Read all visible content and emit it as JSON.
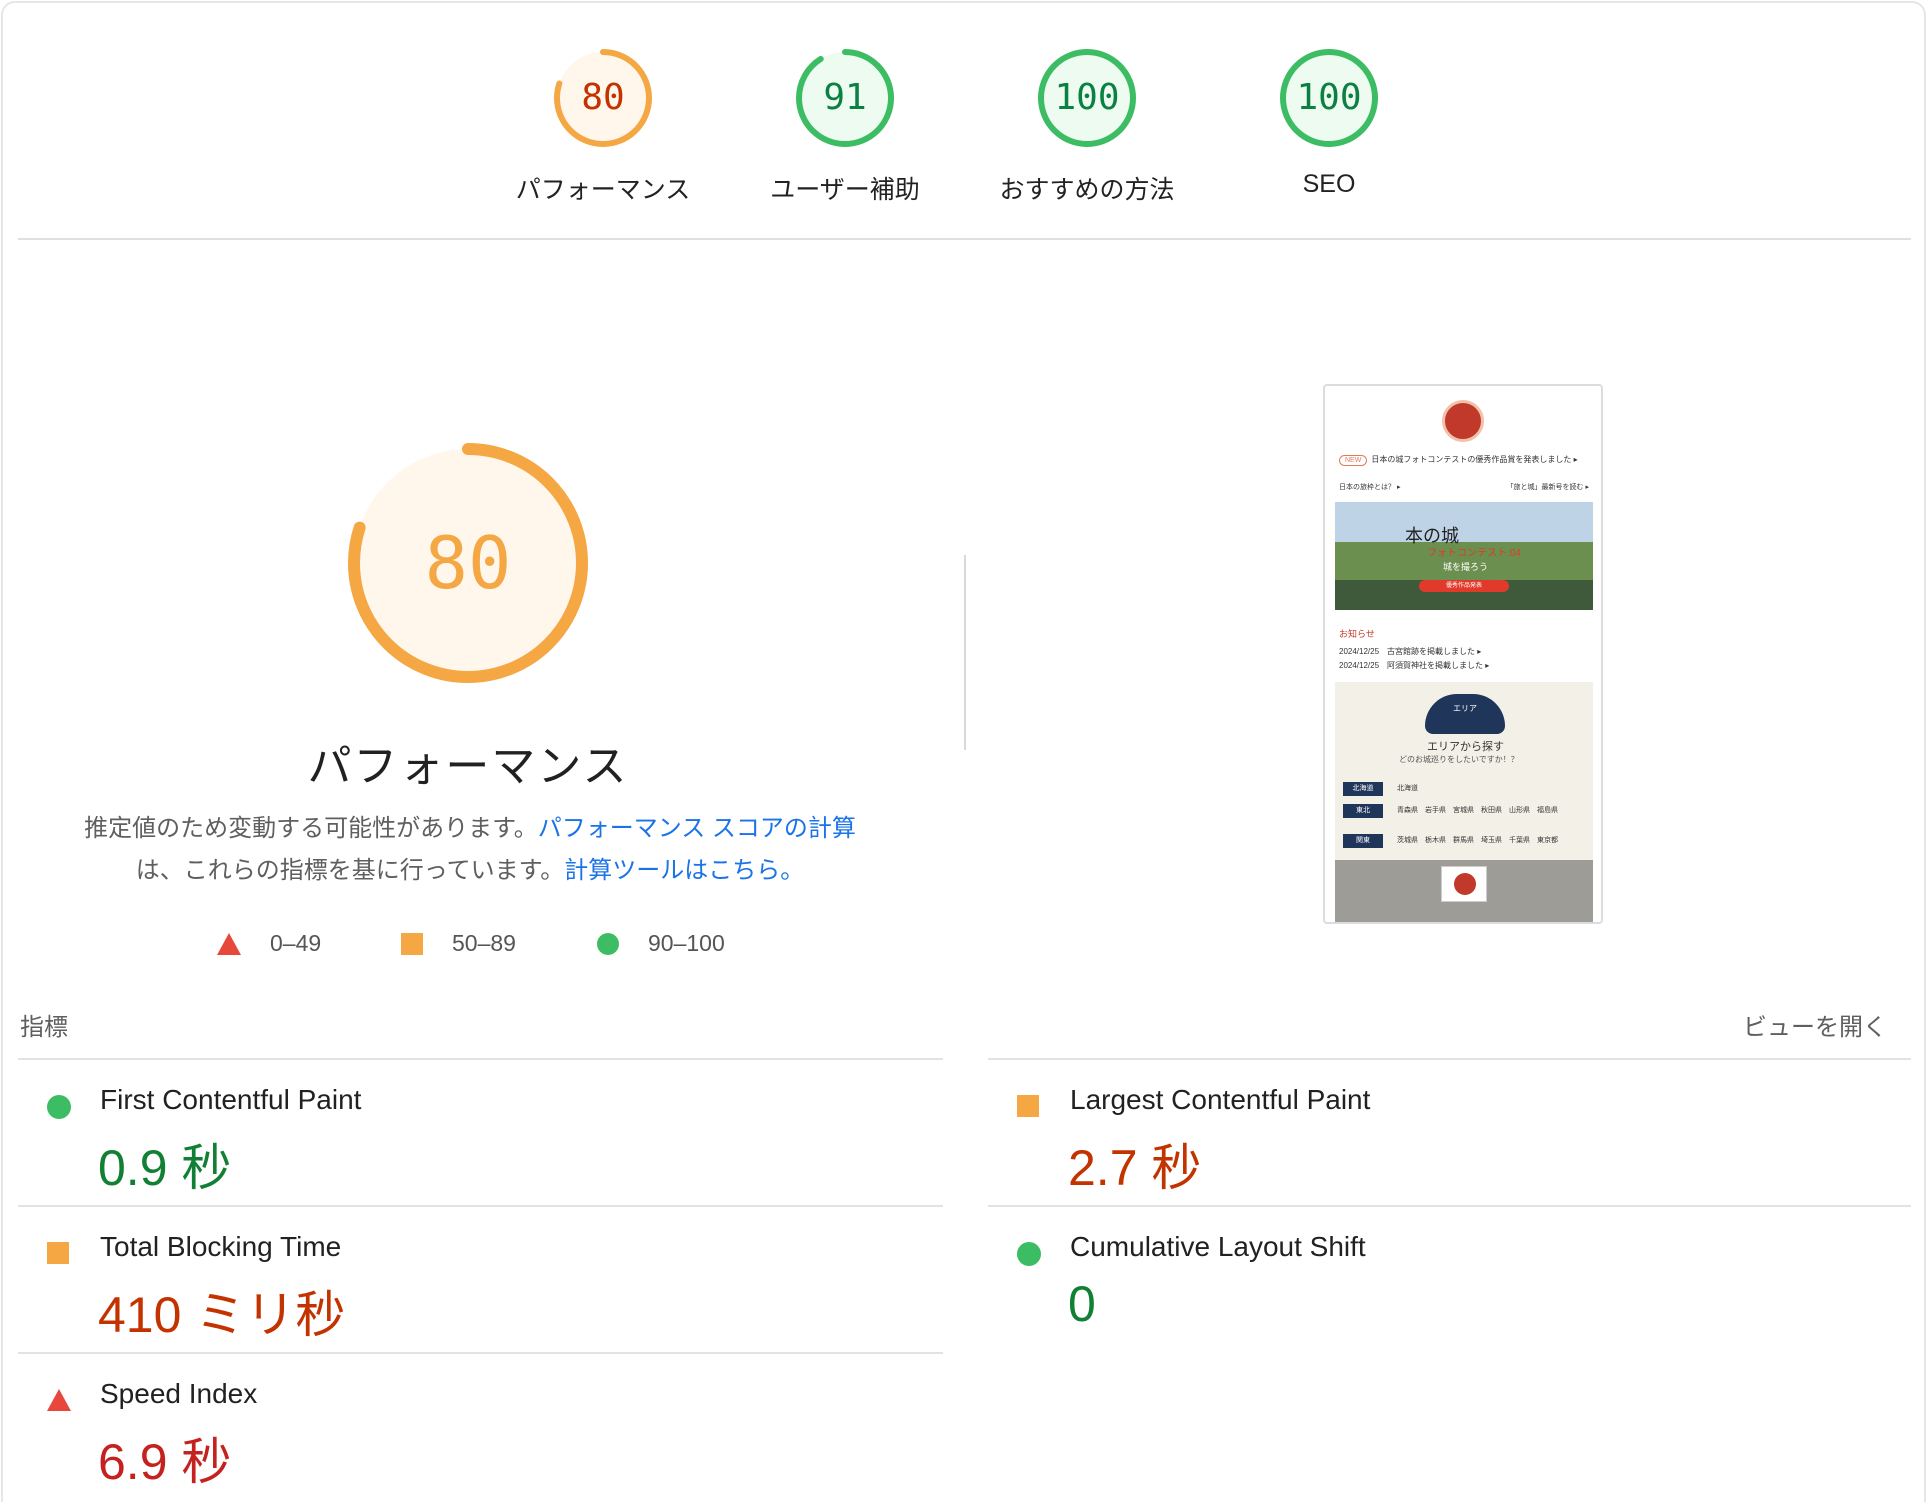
{
  "categories": [
    {
      "score": "80",
      "label": "パフォーマンス",
      "status": "average",
      "value": 80,
      "color": "#f4a742"
    },
    {
      "score": "91",
      "label": "ユーザー補助",
      "status": "pass",
      "value": 91,
      "color": "#3cbc63"
    },
    {
      "score": "100",
      "label": "おすすめの方法",
      "status": "pass",
      "value": 100,
      "color": "#3cbc63"
    },
    {
      "score": "100",
      "label": "SEO",
      "status": "pass",
      "value": 100,
      "color": "#3cbc63"
    }
  ],
  "performance": {
    "score": "80",
    "value": 80,
    "title": "パフォーマンス",
    "desc_text": "推定値のため変動する可能性があります。",
    "desc_link1": "パフォーマンス スコアの計算",
    "desc_text2": "は、これらの指標を基に行っています。",
    "desc_link2": "計算ツールはこちら。"
  },
  "legend": [
    {
      "icon": "red-triangle-icon",
      "range": "0–49"
    },
    {
      "icon": "orange-square-icon",
      "range": "50–89"
    },
    {
      "icon": "green-circle-icon",
      "range": "90–100"
    }
  ],
  "screenshot": {
    "badge": "NEW",
    "news": "日本の城フォトコンテストの優秀作品賞を発表しました ▸",
    "link_left": "日本の旅枠とは？ ▸",
    "link_right": "「旅と城」最新号を読む ▸",
    "hero_title": "本の城",
    "hero_sub": "フォトコンテスト.04",
    "hero_sub2": "城を撮ろう",
    "hero_button": "優秀作品発表",
    "info_title": "お知らせ",
    "info_items": [
      "2024/12/25　古宮館跡を掲載しました ▸",
      "2024/12/25　阿須賀神社を掲載しました ▸"
    ],
    "area_badge": "エリア",
    "area_title": "エリアから探す",
    "area_sub": "どのお城巡りをしたいですか！？",
    "area_rows": [
      {
        "tag": "北海道",
        "items": "北海道"
      },
      {
        "tag": "東北",
        "items": "青森県　岩手県　宮城県　秋田県　山形県　福島県"
      },
      {
        "tag": "関東",
        "items": "茨城県　栃木県　群馬県　埼玉県　千葉県　東京都"
      }
    ]
  },
  "metrics_header": {
    "title": "指標",
    "expand_label": "ビューを開く"
  },
  "metrics": [
    {
      "name": "First Contentful Paint",
      "value": "0.9 秒",
      "status": "pass"
    },
    {
      "name": "Largest Contentful Paint",
      "value": "2.7 秒",
      "status": "average"
    },
    {
      "name": "Total Blocking Time",
      "value": "410 ミリ秒",
      "status": "average"
    },
    {
      "name": "Cumulative Layout Shift",
      "value": "0",
      "status": "pass"
    },
    {
      "name": "Speed Index",
      "value": "6.9 秒",
      "status": "fail"
    }
  ],
  "colors": {
    "pass": "#3cbc63",
    "average": "#f4a742",
    "fail": "#e8483c",
    "link": "#1a73e8"
  }
}
